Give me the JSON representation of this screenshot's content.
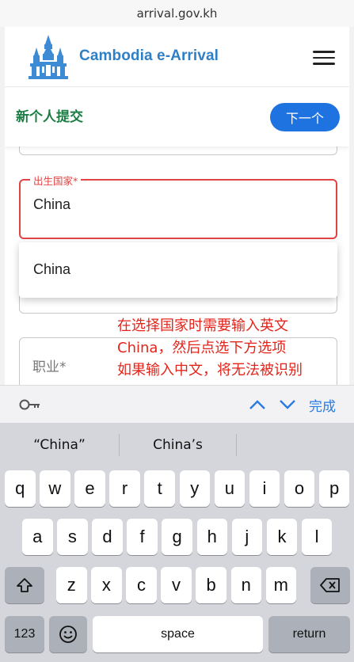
{
  "browser": {
    "url": "arrival.gov.kh"
  },
  "header": {
    "brand": "Cambodia e-Arrival",
    "logo_icon": "angkor-temple-logo",
    "menu_icon": "hamburger-menu-icon"
  },
  "subbar": {
    "title": "新个人提交",
    "next_label": "下一个"
  },
  "form": {
    "country_label": "出生国家*",
    "country_value": "China",
    "dropdown_option": "China",
    "occupation_placeholder": "职业*"
  },
  "annotation": {
    "lines": [
      "在选择国家时需要输入英文",
      "China，然后点选下方选项",
      "如果输入中文，将无法被识别"
    ]
  },
  "keyboard_toolbar": {
    "key_icon": "key-icon",
    "up_icon": "chevron-up-icon",
    "down_icon": "chevron-down-icon",
    "done_label": "完成"
  },
  "keyboard": {
    "suggestions": [
      "“China”",
      "China’s"
    ],
    "row1": [
      "q",
      "w",
      "e",
      "r",
      "t",
      "y",
      "u",
      "i",
      "o",
      "p"
    ],
    "row2": [
      "a",
      "s",
      "d",
      "f",
      "g",
      "h",
      "j",
      "k",
      "l"
    ],
    "row3": [
      "z",
      "x",
      "c",
      "v",
      "b",
      "n",
      "m"
    ],
    "numbers_label": "123",
    "space_label": "space",
    "return_label": "return"
  },
  "colors": {
    "brand_blue": "#2f7fc7",
    "title_green": "#1a7d44",
    "button_blue": "#1e73e0",
    "error_red": "#e14444",
    "annotation_red": "#e3241b"
  }
}
